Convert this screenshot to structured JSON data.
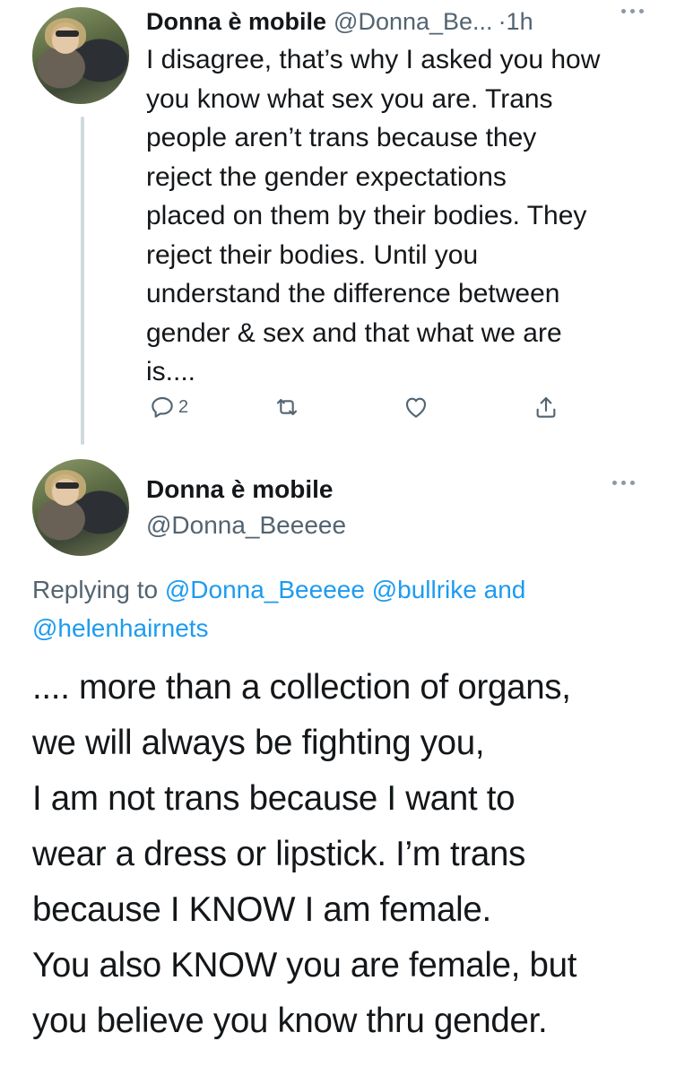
{
  "tweet1": {
    "author_name": "Donna è mobile",
    "handle": "@Donna_Be...",
    "time": "·1h",
    "lines": [
      "I disagree, that’s why I asked you how",
      "you know what sex you are. Trans",
      "people aren’t trans because they",
      "reject the gender expectations",
      "placed on them by their bodies. They",
      "reject their bodies. Until you",
      "understand the difference between",
      "gender & sex and that what we are",
      "is...."
    ],
    "actions": {
      "reply_count": "2",
      "icons": [
        "reply-icon",
        "retweet-icon",
        "like-icon",
        "share-icon"
      ]
    }
  },
  "tweet2": {
    "author_name": "Donna è mobile",
    "handle": "@Donna_Beeeee",
    "replying": {
      "prefix": "Replying to ",
      "mention1": "@Donna_Beeeee",
      "mention2": "@bullrike",
      "joiner": " and",
      "mention3": "@helenhairnets"
    },
    "lines": [
      ".... more than a collection of organs,",
      "we will always be fighting you,",
      "I am not trans because I want to",
      "wear a dress or lipstick. I’m trans",
      "because I KNOW I am female.",
      "You also KNOW you are female, but",
      "you believe you know thru gender."
    ]
  },
  "colors": {
    "text": "#14171a",
    "secondary": "#536471",
    "link": "#1d9bf0",
    "thread_line": "#cfd9de"
  }
}
